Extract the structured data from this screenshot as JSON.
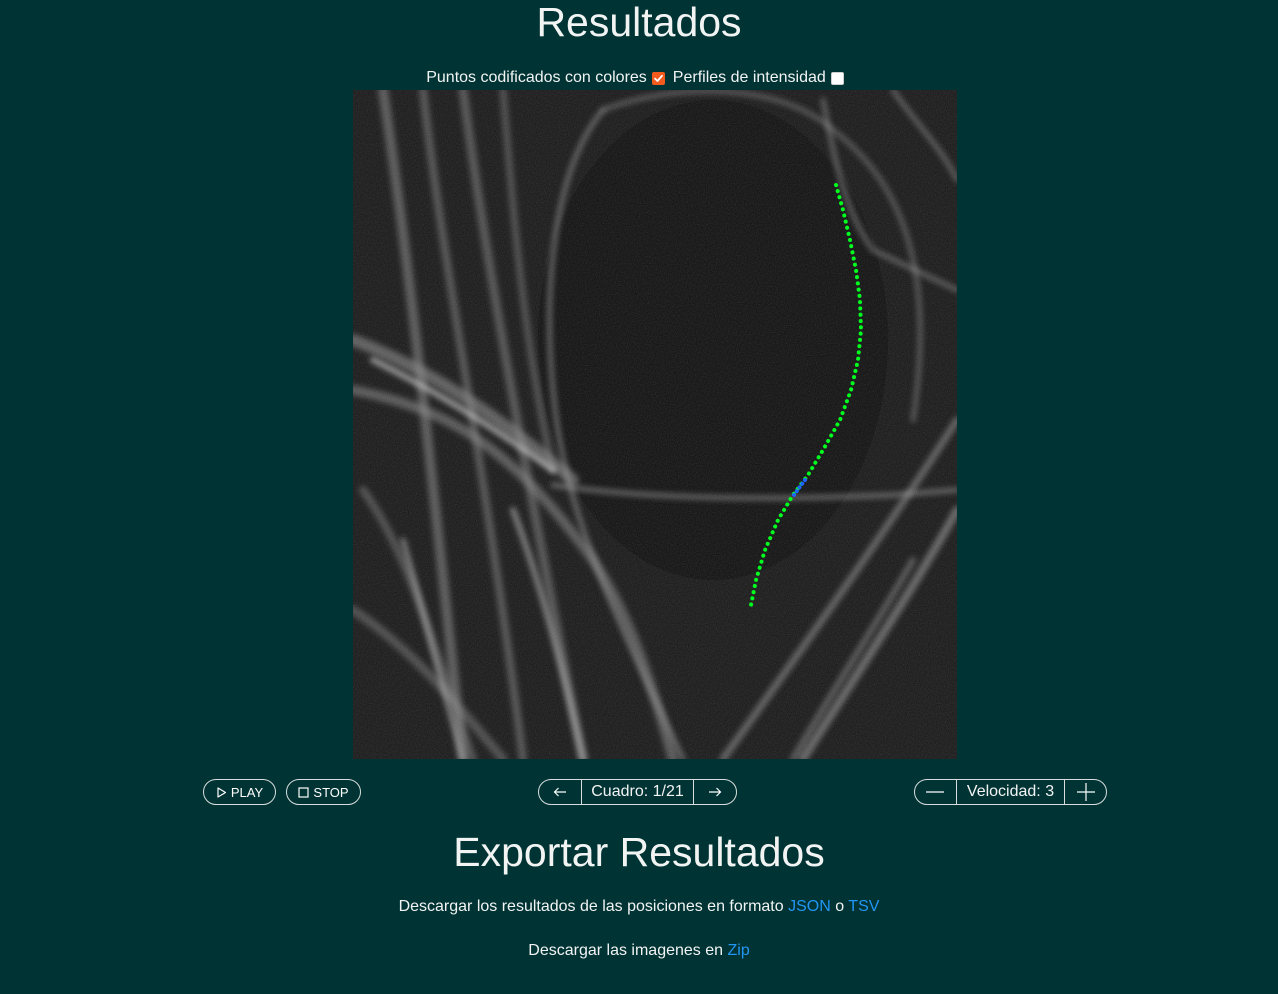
{
  "title": "Resultados",
  "options": {
    "color_points_label": "Puntos codificados con colores",
    "color_points_checked": true,
    "intensity_label": "Perfiles de intensidad",
    "intensity_checked": false
  },
  "viewer": {
    "image": "grayscale microscopy frame with fluorescent filaments",
    "trace_color": "#00ff1e",
    "highlight_color": "#1e64ff"
  },
  "controls": {
    "play_label": "PLAY",
    "stop_label": "STOP",
    "frame_label": "Cuadro: 1/21",
    "speed_label": "Velocidad: 3",
    "prev_icon": "arrow-left-icon",
    "next_icon": "arrow-right-icon",
    "minus_icon": "minus-icon",
    "plus_icon": "plus-icon"
  },
  "export": {
    "title": "Exportar Resultados",
    "positions_text": "Descargar los resultados de las posiciones en formato",
    "json_link": "JSON",
    "or_text": "o",
    "tsv_link": "TSV",
    "images_text": "Descargar las imagenes en",
    "zip_link": "Zip"
  },
  "colors": {
    "background": "#003333",
    "accent_checkbox": "#f25b1d",
    "link": "#2196f3"
  }
}
